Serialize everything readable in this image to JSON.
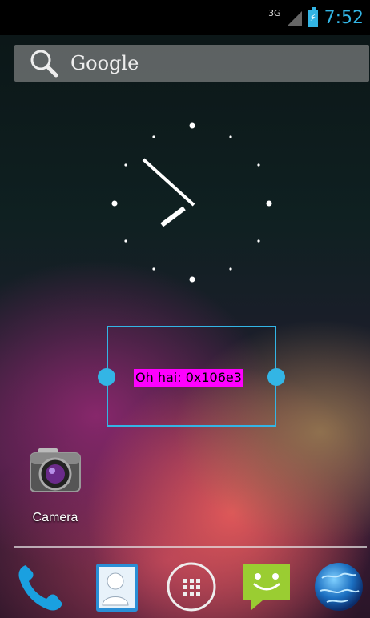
{
  "status_bar": {
    "network_type": "3G",
    "time": "7:52",
    "icons": [
      "signal-icon",
      "battery-charging-icon"
    ]
  },
  "search": {
    "label": "Google",
    "icon": "search-icon"
  },
  "clock_widget": {
    "hour_hand_time": "7:52"
  },
  "widget": {
    "label": "Oh hai: 0x106e3"
  },
  "apps": {
    "camera": {
      "label": "Camera",
      "icon": "camera-icon"
    }
  },
  "dock": {
    "items": [
      "phone-icon",
      "contacts-icon",
      "app-drawer-icon",
      "messaging-icon",
      "browser-icon"
    ]
  },
  "colors": {
    "accent": "#33b5e5",
    "widget_label_bg": "#ff00ff"
  }
}
